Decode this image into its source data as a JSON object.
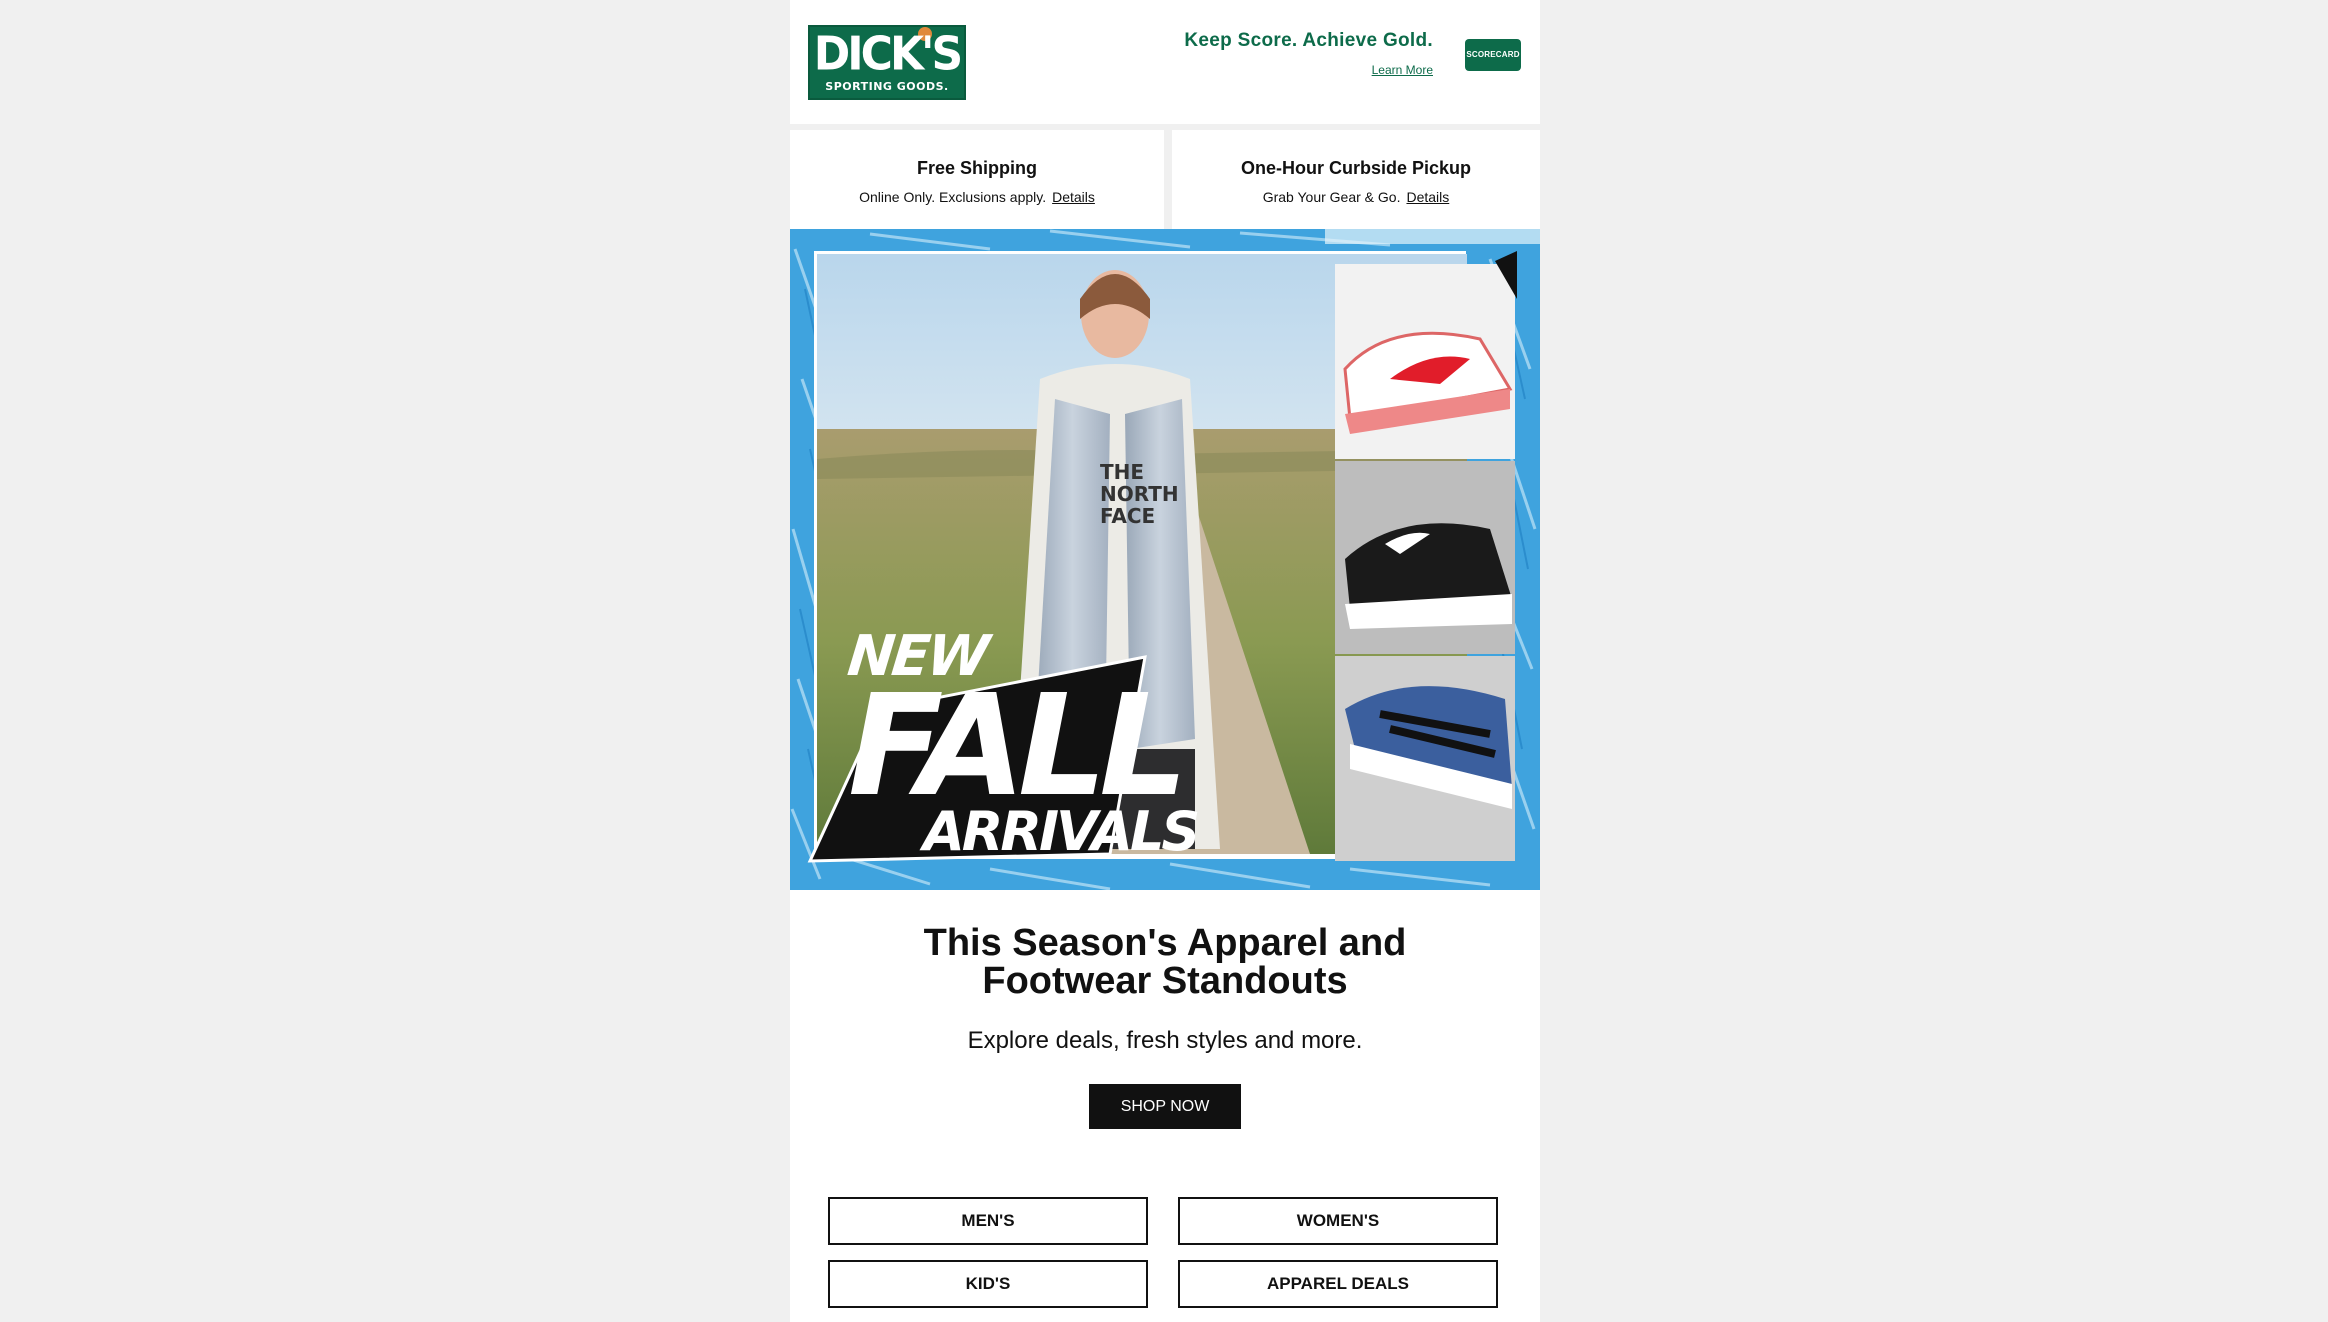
{
  "header": {
    "logo_main": "DICK'S",
    "logo_sub": "SPORTING GOODS.",
    "tagline": "Keep Score. Achieve Gold.",
    "learn_more": "Learn More",
    "scorecard": "SCORECARD"
  },
  "promo_strip": {
    "shipping": {
      "title": "Free Shipping",
      "subtitle": "Online Only. Exclusions apply.",
      "link": "Details"
    },
    "pickup": {
      "title": "One-Hour Curbside Pickup",
      "subtitle": "Grab Your Gear & Go.",
      "link": "Details"
    }
  },
  "hero": {
    "line1": "NEW",
    "line2": "FALL",
    "line3": "ARRIVALS",
    "shirt_text": [
      "THE",
      "NORTH",
      "FACE"
    ]
  },
  "content": {
    "headline_line1": "This Season's Apparel and",
    "headline_line2": "Footwear Standouts",
    "subhead": "Explore deals, fresh styles and more.",
    "cta": "SHOP NOW"
  },
  "categories": {
    "mens": "MEN'S",
    "womens": "WOMEN'S",
    "kids": "KID'S",
    "apparel_deals": "APPAREL DEALS"
  },
  "colors": {
    "brand_green": "#0d6b4a",
    "hero_blue": "#3fa3de",
    "button_black": "#111111"
  }
}
